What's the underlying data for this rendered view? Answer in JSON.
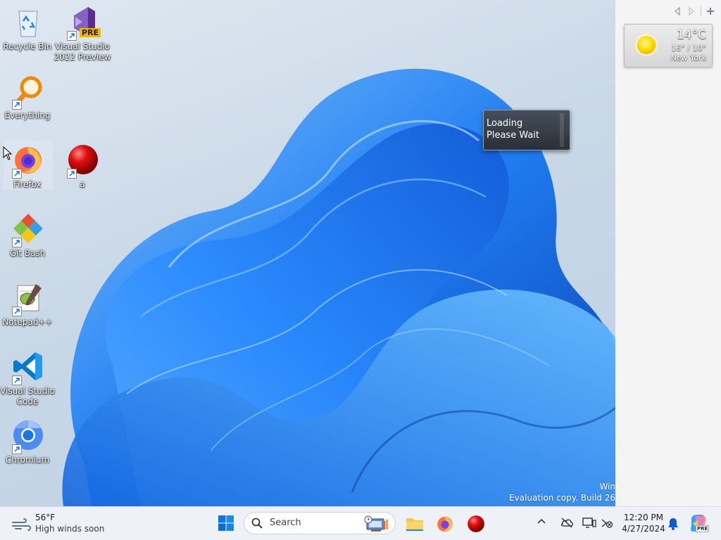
{
  "desktop": {
    "icons": [
      {
        "label": "Recycle Bin",
        "icon": "recycle-bin-icon"
      },
      {
        "label": "Visual Studio 2022 Preview",
        "line1": "Visual Studio",
        "line2": "2022 Preview",
        "icon": "visual-studio-icon",
        "badge": "PRE"
      },
      {
        "label": "Everything",
        "icon": "everything-search-icon"
      },
      {
        "label": "Firefox",
        "icon": "firefox-icon"
      },
      {
        "label": "a",
        "icon": "red-ball-icon"
      },
      {
        "label": "Git Bash",
        "icon": "git-bash-icon"
      },
      {
        "label": "Notepad++",
        "icon": "notepad-plus-plus-icon"
      },
      {
        "label": "Visual Studio Code",
        "line1": "Visual Studio",
        "line2": "Code",
        "icon": "vscode-icon"
      },
      {
        "label": "Chromium",
        "icon": "chromium-icon"
      }
    ],
    "loading_popup": {
      "line1": "Loading",
      "line2": "Please Wait"
    },
    "watermark": {
      "line1": "Win",
      "line2": "Evaluation copy. Build 26"
    }
  },
  "gadgets": {
    "weather": {
      "temp": "14°C",
      "range": "16° / 10°",
      "city": "New York",
      "icon": "sun-icon"
    }
  },
  "taskbar": {
    "weather": {
      "temp": "56°F",
      "forecast": "High winds soon",
      "icon": "wind-icon"
    },
    "search": {
      "placeholder": "Search"
    },
    "pinned": [
      "file-explorer-icon",
      "firefox-icon",
      "red-ball-icon"
    ],
    "tray": [
      "chevron-up-icon",
      "onedrive-offline-icon",
      "display-icon",
      "network-disconnected-icon"
    ],
    "clock": {
      "time": "12:20 PM",
      "date": "4/27/2024"
    },
    "notification_icon": "bell-icon",
    "copilot_badge": "PRE"
  },
  "colors": {
    "accent": "#0a5fd6",
    "taskbar_bg": "#eef1f6",
    "sidebar_bg": "#f4f4f4"
  }
}
